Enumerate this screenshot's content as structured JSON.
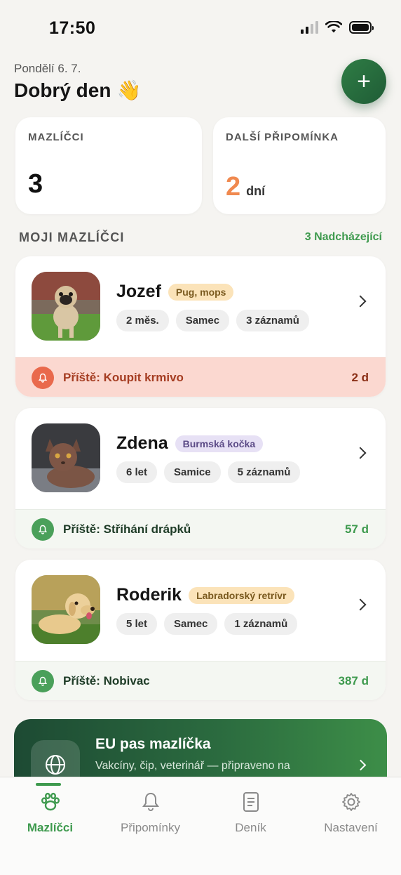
{
  "status": {
    "time": "17:50"
  },
  "header": {
    "date": "Pondělí 6. 7.",
    "greeting": "Dobrý den",
    "greeting_emoji": "👋",
    "add_icon": "plus-icon"
  },
  "stats": {
    "pets_label": "MAZLÍČCI",
    "pets_value": "3",
    "next_label": "DALŠÍ PŘIPOMÍNKA",
    "next_value": "2",
    "next_unit": "dní"
  },
  "section": {
    "title": "MOJI MAZLÍČCI",
    "link": "3 Nadcházející"
  },
  "pets": [
    {
      "name": "Jozef",
      "breed": "Pug, mops",
      "tags": [
        "2 měs.",
        "Samec",
        "3 záznamů"
      ],
      "reminder": "Příště: Koupit krmivo",
      "days": "2 d",
      "urgency": "urgent",
      "photo": "pug-photo"
    },
    {
      "name": "Zdena",
      "breed": "Burmská kočka",
      "tags": [
        "6 let",
        "Samice",
        "5 záznamů"
      ],
      "reminder": "Příště: Stříhání drápků",
      "days": "57 d",
      "urgency": "normal",
      "photo": "cat-photo"
    },
    {
      "name": "Roderik",
      "breed": "Labradorský retrívr",
      "tags": [
        "5 let",
        "Samec",
        "1 záznamů"
      ],
      "reminder": "Příště: Nobivac",
      "days": "387 d",
      "urgency": "normal",
      "photo": "labrador-photo"
    }
  ],
  "eu_banner": {
    "title": "EU pas mazlíčka",
    "subtitle": "Vakcíny, čip, veterinář — připraveno na",
    "icon": "globe-icon"
  },
  "tabs": [
    {
      "label": "Mazlíčci",
      "icon": "paw-icon",
      "active": true
    },
    {
      "label": "Připomínky",
      "icon": "bell-icon",
      "active": false
    },
    {
      "label": "Deník",
      "icon": "document-icon",
      "active": false
    },
    {
      "label": "Nastavení",
      "icon": "gear-icon",
      "active": false
    }
  ],
  "colors": {
    "accent": "#3e9a4e",
    "accent_dark": "#1f5c36",
    "warning": "#f0894f",
    "urgent_bg": "#fbd8d0",
    "urgent_text": "#a53d22",
    "background": "#f5f4f1"
  }
}
